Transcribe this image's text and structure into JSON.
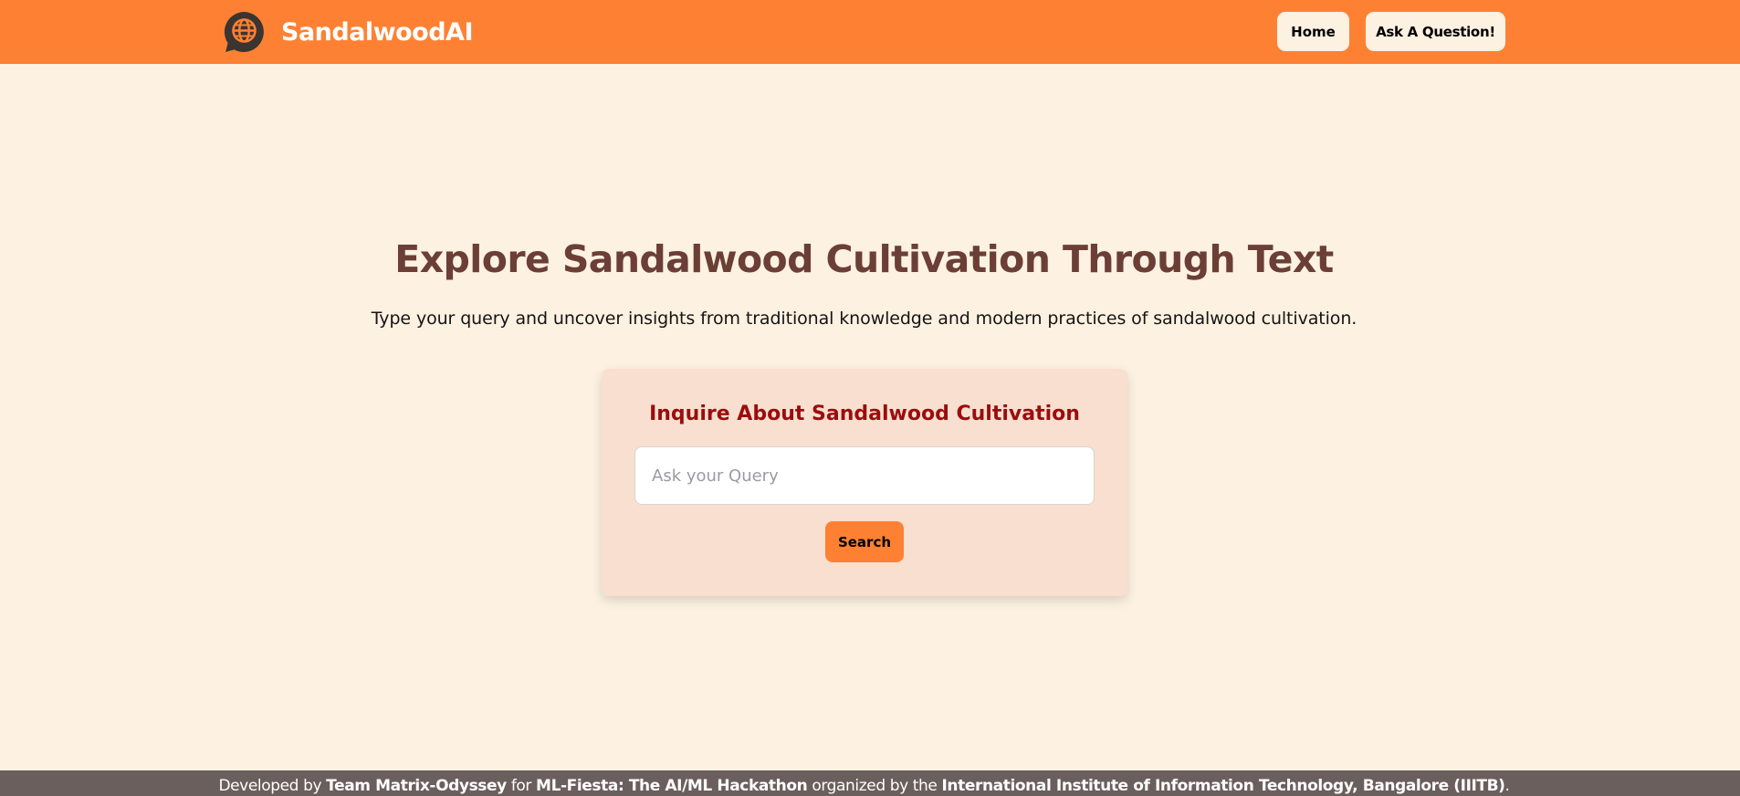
{
  "header": {
    "brand_name": "SandalwoodAI",
    "logo_icon": "globe-chat-bubble-icon",
    "nav": {
      "home_label": "Home",
      "ask_label": "Ask A Question!"
    }
  },
  "hero": {
    "title": "Explore Sandalwood Cultivation Through Text",
    "subtitle": "Type your query and uncover insights from traditional knowledge and modern practices of sandalwood cultivation."
  },
  "query_card": {
    "title": "Inquire About Sandalwood Cultivation",
    "input_value": "",
    "input_placeholder": "Ask your Query",
    "search_label": "Search"
  },
  "footer": {
    "developed_by": "Developed by",
    "team": "Team Matrix-Odyssey",
    "for_text": "for",
    "event": "ML-Fiesta: The AI/ML Hackathon",
    "organized_text": "organized by the",
    "organizer": "International Institute of Information Technology, Bangalore (IIITB)",
    "period": "."
  },
  "colors": {
    "navbar": "#fe8133",
    "page_background": "#fdf1e1",
    "hero_title": "#6b3e36",
    "card_background": "#f9dfd0",
    "card_title": "#9b0d0d",
    "search_button": "#fe8133",
    "footer_background": "#6b5f5d"
  }
}
